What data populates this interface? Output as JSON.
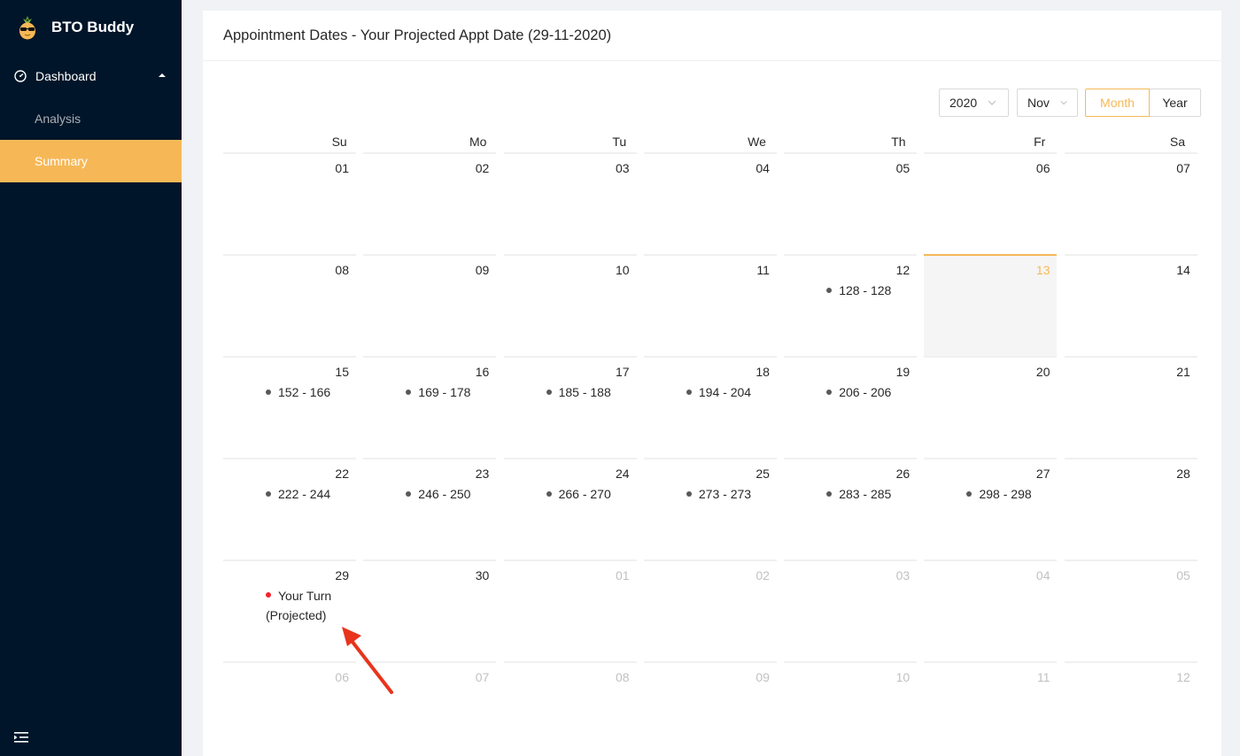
{
  "app": {
    "brand": "BTO Buddy"
  },
  "sidebar": {
    "dashboard_label": "Dashboard",
    "items": [
      {
        "label": "Analysis"
      },
      {
        "label": "Summary"
      }
    ]
  },
  "card": {
    "title": "Appointment Dates - Your Projected Appt Date (29-11-2020)"
  },
  "controls": {
    "year": "2020",
    "month": "Nov",
    "mode_month": "Month",
    "mode_year": "Year"
  },
  "calendar": {
    "weekdays": [
      "Su",
      "Mo",
      "Tu",
      "We",
      "Th",
      "Fr",
      "Sa"
    ],
    "weeks": [
      [
        {
          "d": "01"
        },
        {
          "d": "02"
        },
        {
          "d": "03"
        },
        {
          "d": "04"
        },
        {
          "d": "05"
        },
        {
          "d": "06"
        },
        {
          "d": "07"
        }
      ],
      [
        {
          "d": "08"
        },
        {
          "d": "09"
        },
        {
          "d": "10"
        },
        {
          "d": "11"
        },
        {
          "d": "12",
          "e": "128 - 128"
        },
        {
          "d": "13"
        },
        {
          "d": "14"
        }
      ],
      [
        {
          "d": "15",
          "e": "152 - 166"
        },
        {
          "d": "16",
          "e": "169 - 178"
        },
        {
          "d": "17",
          "e": "185 - 188"
        },
        {
          "d": "18",
          "e": "194 - 204"
        },
        {
          "d": "19",
          "e": "206 - 206"
        },
        {
          "d": "20"
        },
        {
          "d": "21"
        }
      ],
      [
        {
          "d": "22",
          "e": "222 - 244"
        },
        {
          "d": "23",
          "e": "246 - 250"
        },
        {
          "d": "24",
          "e": "266 - 270"
        },
        {
          "d": "25",
          "e": "273 - 273"
        },
        {
          "d": "26",
          "e": "283 - 285"
        },
        {
          "d": "27",
          "e": "298 - 298"
        },
        {
          "d": "28"
        }
      ],
      [
        {
          "d": "29",
          "e": "Your Turn (Projected)"
        },
        {
          "d": "30"
        },
        {
          "d": "01"
        },
        {
          "d": "02"
        },
        {
          "d": "03"
        },
        {
          "d": "04"
        },
        {
          "d": "05"
        }
      ],
      [
        {
          "d": "06"
        },
        {
          "d": "07"
        },
        {
          "d": "08"
        },
        {
          "d": "09"
        },
        {
          "d": "10"
        },
        {
          "d": "11"
        },
        {
          "d": "12"
        }
      ]
    ]
  },
  "colors": {
    "accent": "#f6b857",
    "sidebar_bg": "#001529",
    "turn_dot": "#f5222d",
    "arrow": "#e8341c"
  },
  "icons": {
    "logo": "pineapple-logo-icon",
    "dashboard": "dashboard-gauge-icon",
    "caret": "caret-up-icon",
    "collapse": "menu-fold-icon",
    "select": "chevron-down-icon",
    "annotation": "red-arrow-icon"
  }
}
